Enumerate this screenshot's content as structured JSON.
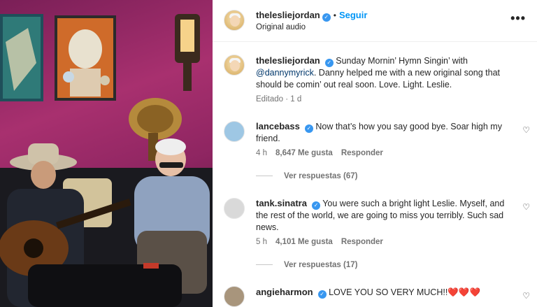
{
  "post": {
    "author": "theleslie jordan",
    "author_handle": "thelesliejordan",
    "follow_label": "Seguir",
    "audio": "Original audio",
    "caption_prefix": "Sunday Mornin’ Hymn Singin’ with",
    "caption_mention": "@dannymyrick",
    "caption_rest": ". Danny helped me with a new original song that should be comin’ out real soon. Love. Light. Leslie.",
    "edited": "Editado · 1 d",
    "more_icon": "more-horizontal-icon"
  },
  "comments": [
    {
      "user": "lancebass",
      "text": "Now that’s how you say good bye. Soar high my friend.",
      "time": "4 h",
      "likes": "8,647 Me gusta",
      "reply": "Responder",
      "view_replies": "Ver respuestas (67)"
    },
    {
      "user": "tank.sinatra",
      "text": "You were such a bright light Leslie. Myself, and the rest of the world, we are going to miss you terribly. Such sad news.",
      "time": "5 h",
      "likes": "4,101 Me gusta",
      "reply": "Responder",
      "view_replies": "Ver respuestas (17)"
    },
    {
      "user": "angieharmon",
      "text": "LOVE YOU SO VERY MUCH!!",
      "hearts": "❤️❤️❤️"
    }
  ],
  "colors": {
    "accent": "#0095f6",
    "verified": "#3897f0",
    "muted": "#737373"
  }
}
